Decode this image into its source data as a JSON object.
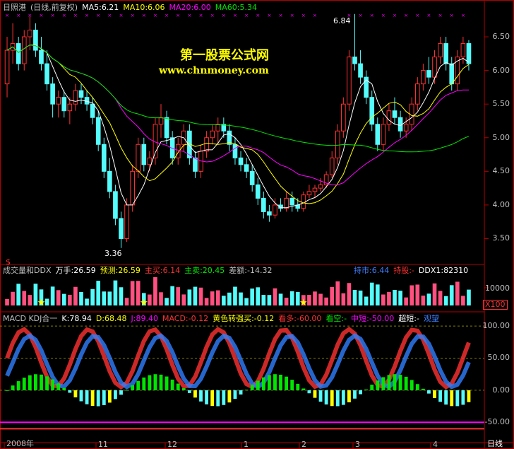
{
  "watermark": {
    "line1": "第一股票公式网",
    "line2": "www.chnmoney.com"
  },
  "main": {
    "stock": "日照港",
    "mode": "(日线,前复权)",
    "ma5": "MA5:6.21",
    "ma10": "MA10:6.06",
    "ma20": "MA20:6.00",
    "ma60": "MA60:5.34",
    "high_label": "6.84",
    "low_label": "3.36",
    "y_ticks": [
      "6.50",
      "6.00",
      "5.50",
      "5.00",
      "4.50",
      "4.00",
      "3.50"
    ],
    "s_marker": "$"
  },
  "vol": {
    "name": "成交量和DDX",
    "wanshou": "万手:26.59",
    "yuce": "预测:26.59",
    "zhumai": "主买:6.14",
    "zhumai2": "主卖:20.45",
    "chae": "差额:-14.32",
    "chishi": "持市:6.44",
    "chigu": "持股:-",
    "ddx1": "DDX1:82310",
    "y_tick": "10000",
    "x_scale": "X100"
  },
  "macd": {
    "name": "MACD KDJ合一",
    "k": "K:78.94",
    "d": "D:68.48",
    "j": "J:89.40",
    "macd": "MACD:-0.12",
    "yellow": "黄色转强买:-0.12",
    "kanduo": "看多:-60.00",
    "kankong": "看空:-",
    "zhongduan": "中短:-50.00",
    "chaoduan": "超短:-",
    "guanwang": "观望",
    "y_ticks": [
      "100.00",
      "50.00",
      "0.00",
      "-50.00"
    ]
  },
  "dates": [
    "2008年",
    "11",
    "12",
    "1",
    "2",
    "3",
    "4"
  ],
  "period_label": "日线",
  "colors": {
    "up": "#ff3232",
    "down": "#54fcfc",
    "ma5": "#ffffff",
    "ma10": "#ffff00",
    "ma20": "#ff00ff",
    "ma60": "#00e600",
    "frame": "#b40000"
  },
  "chart_data": {
    "type": "candlestick",
    "ohlc": [
      [
        5.8,
        6.5,
        5.6,
        6.3
      ],
      [
        6.3,
        6.7,
        6.1,
        6.4
      ],
      [
        6.4,
        6.5,
        6.0,
        6.1
      ],
      [
        6.1,
        6.6,
        6.0,
        6.5
      ],
      [
        6.5,
        6.8,
        6.3,
        6.6
      ],
      [
        6.6,
        6.7,
        6.2,
        6.3
      ],
      [
        6.3,
        6.5,
        6.0,
        6.1
      ],
      [
        6.1,
        6.3,
        5.7,
        5.8
      ],
      [
        5.8,
        5.9,
        5.3,
        5.5
      ],
      [
        5.5,
        5.7,
        5.3,
        5.6
      ],
      [
        5.6,
        5.7,
        5.3,
        5.4
      ],
      [
        5.4,
        5.6,
        5.2,
        5.5
      ],
      [
        5.5,
        5.8,
        5.4,
        5.7
      ],
      [
        5.7,
        5.8,
        5.5,
        5.6
      ],
      [
        5.6,
        5.7,
        5.4,
        5.5
      ],
      [
        5.5,
        5.6,
        5.2,
        5.3
      ],
      [
        5.3,
        5.4,
        4.8,
        4.9
      ],
      [
        4.9,
        5.0,
        4.4,
        4.5
      ],
      [
        4.5,
        4.7,
        4.1,
        4.2
      ],
      [
        4.2,
        4.3,
        3.7,
        3.8
      ],
      [
        3.8,
        3.9,
        3.36,
        3.5
      ],
      [
        3.5,
        4.1,
        3.45,
        4.0
      ],
      [
        4.0,
        4.6,
        3.9,
        4.5
      ],
      [
        4.5,
        5.0,
        4.4,
        4.9
      ],
      [
        4.9,
        5.0,
        4.5,
        4.6
      ],
      [
        4.6,
        4.8,
        4.5,
        4.7
      ],
      [
        4.7,
        5.3,
        4.6,
        5.2
      ],
      [
        5.2,
        5.5,
        5.0,
        5.3
      ],
      [
        5.3,
        5.4,
        4.9,
        5.0
      ],
      [
        5.0,
        5.1,
        4.6,
        4.7
      ],
      [
        4.7,
        5.0,
        4.6,
        4.9
      ],
      [
        4.9,
        5.2,
        4.8,
        5.1
      ],
      [
        5.1,
        5.2,
        4.6,
        4.7
      ],
      [
        4.7,
        4.8,
        4.4,
        4.5
      ],
      [
        4.5,
        4.9,
        4.4,
        4.8
      ],
      [
        4.8,
        5.1,
        4.7,
        5.0
      ],
      [
        5.0,
        5.2,
        4.9,
        5.1
      ],
      [
        5.1,
        5.3,
        4.9,
        5.2
      ],
      [
        5.2,
        5.3,
        5.0,
        5.1
      ],
      [
        5.1,
        5.2,
        4.8,
        4.9
      ],
      [
        4.9,
        5.0,
        4.6,
        4.7
      ],
      [
        4.7,
        4.8,
        4.5,
        4.6
      ],
      [
        4.6,
        4.7,
        4.4,
        4.5
      ],
      [
        4.5,
        4.6,
        4.2,
        4.3
      ],
      [
        4.3,
        4.4,
        4.0,
        4.1
      ],
      [
        4.1,
        4.2,
        3.8,
        3.9
      ],
      [
        3.9,
        4.0,
        3.75,
        3.85
      ],
      [
        3.85,
        4.1,
        3.8,
        4.0
      ],
      [
        4.0,
        4.1,
        3.9,
        3.95
      ],
      [
        3.95,
        4.2,
        3.9,
        4.1
      ],
      [
        4.1,
        4.2,
        3.9,
        4.0
      ],
      [
        4.0,
        4.1,
        3.9,
        3.95
      ],
      [
        3.95,
        4.2,
        3.9,
        4.15
      ],
      [
        4.15,
        4.3,
        4.1,
        4.2
      ],
      [
        4.2,
        4.3,
        4.1,
        4.25
      ],
      [
        4.25,
        4.4,
        4.2,
        4.3
      ],
      [
        4.3,
        4.5,
        4.25,
        4.45
      ],
      [
        4.45,
        4.8,
        4.4,
        4.7
      ],
      [
        4.7,
        5.2,
        4.6,
        5.1
      ],
      [
        5.1,
        5.6,
        5.0,
        5.5
      ],
      [
        5.5,
        6.3,
        5.4,
        6.2
      ],
      [
        6.2,
        6.84,
        6.0,
        6.1
      ],
      [
        6.1,
        6.3,
        5.8,
        5.9
      ],
      [
        5.9,
        6.0,
        5.5,
        5.6
      ],
      [
        5.6,
        5.7,
        5.1,
        5.2
      ],
      [
        5.2,
        5.3,
        4.8,
        4.9
      ],
      [
        4.9,
        5.3,
        4.8,
        5.2
      ],
      [
        5.2,
        5.5,
        5.1,
        5.4
      ],
      [
        5.4,
        5.6,
        5.2,
        5.3
      ],
      [
        5.3,
        5.4,
        5.0,
        5.1
      ],
      [
        5.1,
        5.3,
        5.0,
        5.2
      ],
      [
        5.2,
        5.6,
        5.1,
        5.5
      ],
      [
        5.5,
        5.9,
        5.4,
        5.8
      ],
      [
        5.8,
        6.1,
        5.7,
        6.0
      ],
      [
        6.0,
        6.2,
        5.8,
        5.9
      ],
      [
        5.9,
        6.3,
        5.8,
        6.2
      ],
      [
        6.2,
        6.5,
        6.1,
        6.4
      ],
      [
        6.4,
        6.5,
        6.0,
        6.1
      ],
      [
        6.1,
        6.2,
        5.7,
        5.8
      ],
      [
        5.8,
        6.3,
        5.7,
        6.2
      ],
      [
        6.2,
        6.5,
        6.1,
        6.4
      ],
      [
        6.4,
        6.45,
        6.0,
        6.1
      ]
    ],
    "ma_labels": [
      "MA5:6.21",
      "MA10:6.06",
      "MA20:6.00",
      "MA60:5.34"
    ],
    "ylim": [
      3.2,
      6.9
    ],
    "macd_ylim": [
      -75,
      110
    ]
  }
}
